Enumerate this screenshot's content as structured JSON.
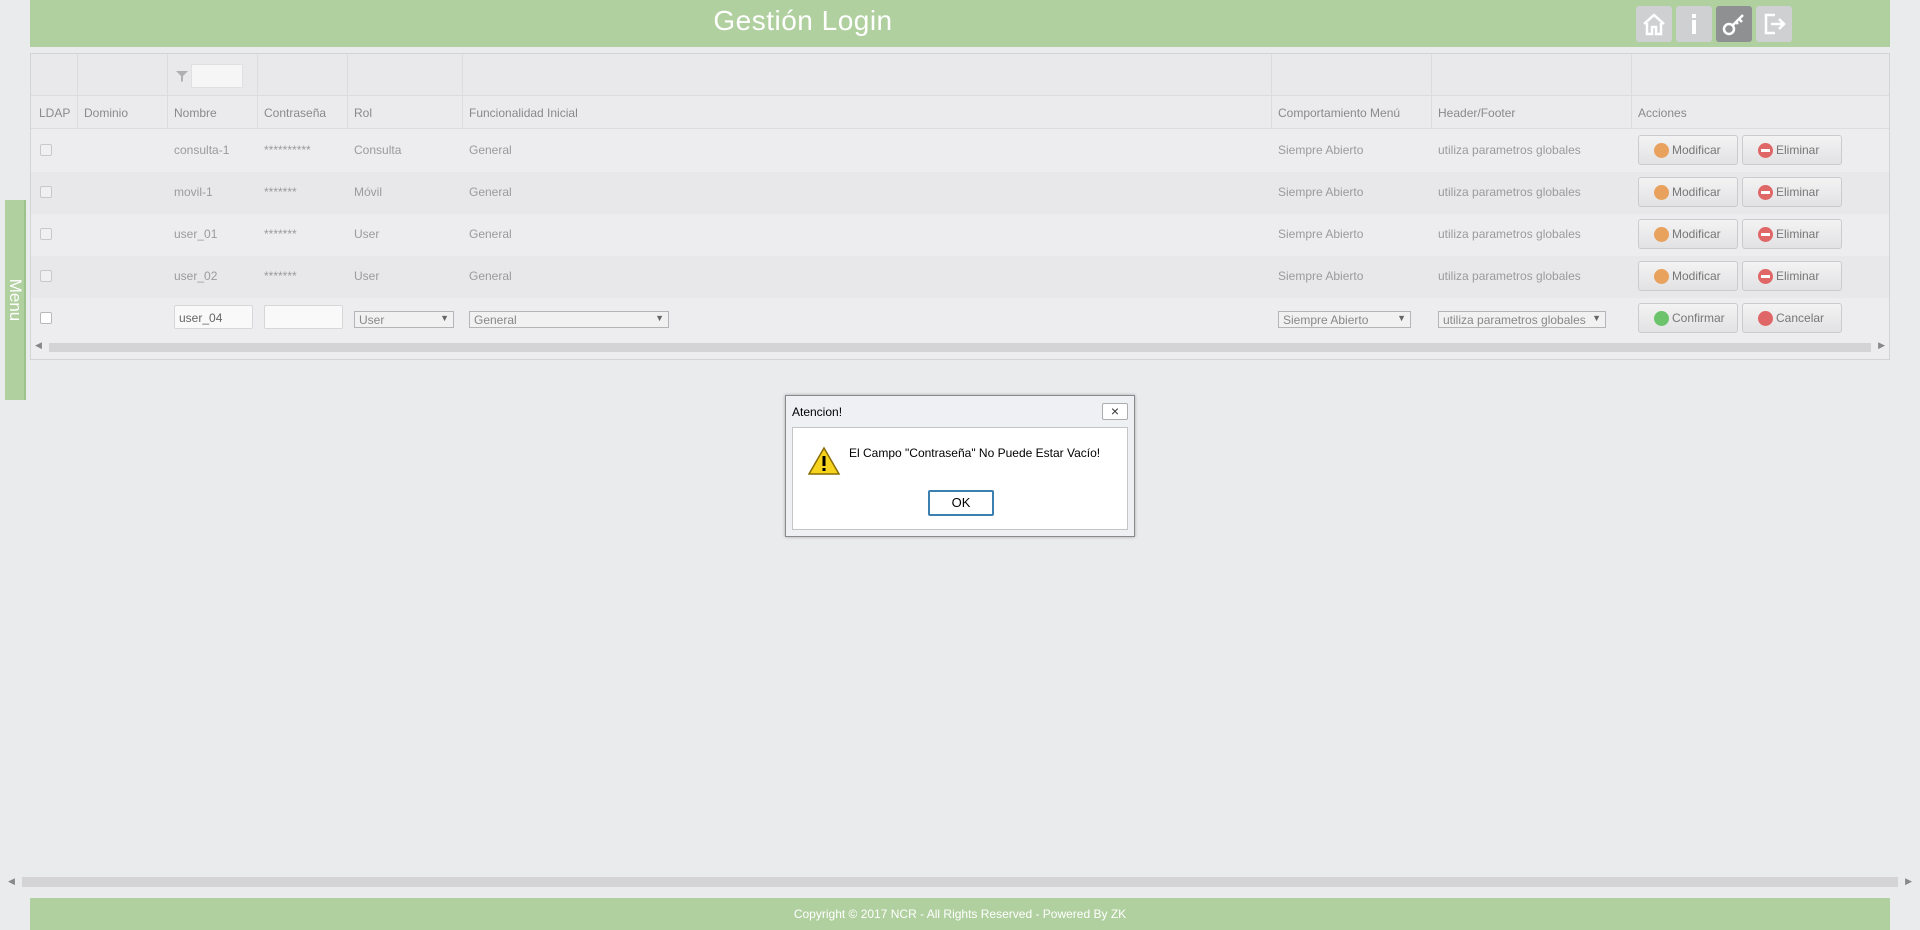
{
  "header": {
    "title": "Gestión Login",
    "buttons": [
      {
        "name": "home-icon"
      },
      {
        "name": "info-icon"
      },
      {
        "name": "key-icon",
        "active": true
      },
      {
        "name": "logout-icon"
      }
    ]
  },
  "menu_tab": {
    "label": "Menu"
  },
  "grid": {
    "columns": {
      "ldap": "LDAP",
      "dominio": "Dominio",
      "nombre": "Nombre",
      "contrasena": "Contraseña",
      "rol": "Rol",
      "funcionalidad": "Funcionalidad Inicial",
      "comportamiento": "Comportamiento Menú",
      "header_footer": "Header/Footer",
      "acciones": "Acciones"
    },
    "filter": {
      "value": ""
    },
    "rows": [
      {
        "nombre": "consulta-1",
        "contrasena": "**********",
        "rol": "Consulta",
        "funcionalidad": "General",
        "comportamiento": "Siempre Abierto",
        "header_footer": "utiliza parametros globales",
        "modificar": "Modificar",
        "eliminar": "Eliminar"
      },
      {
        "nombre": "movil-1",
        "contrasena": "*******",
        "rol": "Móvil",
        "funcionalidad": "General",
        "comportamiento": "Siempre Abierto",
        "header_footer": "utiliza parametros globales",
        "modificar": "Modificar",
        "eliminar": "Eliminar"
      },
      {
        "nombre": "user_01",
        "contrasena": "*******",
        "rol": "User",
        "funcionalidad": "General",
        "comportamiento": "Siempre Abierto",
        "header_footer": "utiliza parametros globales",
        "modificar": "Modificar",
        "eliminar": "Eliminar"
      },
      {
        "nombre": "user_02",
        "contrasena": "*******",
        "rol": "User",
        "funcionalidad": "General",
        "comportamiento": "Siempre Abierto",
        "header_footer": "utiliza parametros globales",
        "modificar": "Modificar",
        "eliminar": "Eliminar"
      }
    ],
    "edit_row": {
      "nombre": "user_04",
      "contrasena": "",
      "rol": "User",
      "funcionalidad": "General",
      "comportamiento": "Siempre Abierto",
      "header_footer": "utiliza parametros globales",
      "confirmar": "Confirmar",
      "cancelar": "Cancelar"
    }
  },
  "dialog": {
    "title": "Atencion!",
    "close": "×",
    "message": "El Campo \"Contraseña\" No Puede Estar Vacío!",
    "ok": "OK"
  },
  "footer": {
    "text": "Copyright © 2017 NCR - All Rights Reserved - Powered By ZK"
  }
}
